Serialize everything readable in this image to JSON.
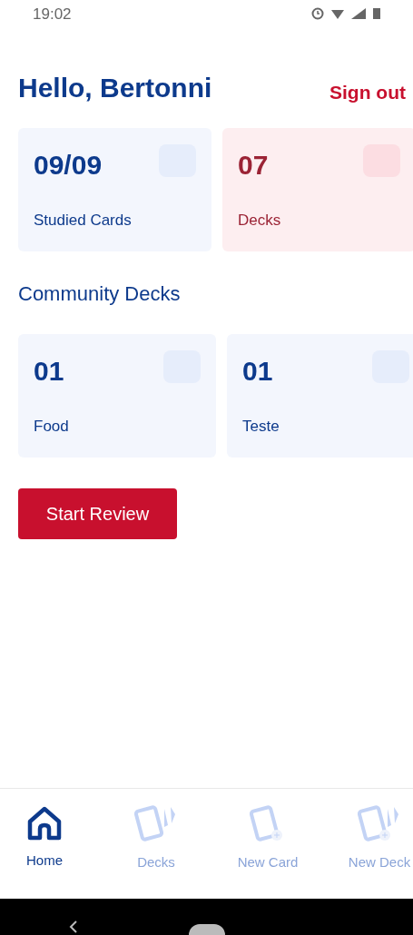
{
  "status_bar": {
    "time": "19:02"
  },
  "header": {
    "greeting": "Hello, Bertonni",
    "sign_out": "Sign out"
  },
  "stats": [
    {
      "value": "09/09",
      "label": "Studied Cards",
      "color": "#0d3a8c"
    },
    {
      "value": "07",
      "label": "Decks",
      "color": "#9b2335"
    }
  ],
  "community": {
    "title": "Community Decks",
    "decks": [
      {
        "value": "01",
        "label": "Food"
      },
      {
        "value": "01",
        "label": "Teste"
      }
    ]
  },
  "start_button": "Start Review",
  "nav": [
    {
      "kind": "home",
      "label": "Home",
      "selected": true
    },
    {
      "kind": "decks",
      "label": "Decks",
      "selected": false
    },
    {
      "kind": "new-card",
      "label": "New Card",
      "selected": false
    },
    {
      "kind": "new-deck",
      "label": "New Deck",
      "selected": false
    }
  ]
}
